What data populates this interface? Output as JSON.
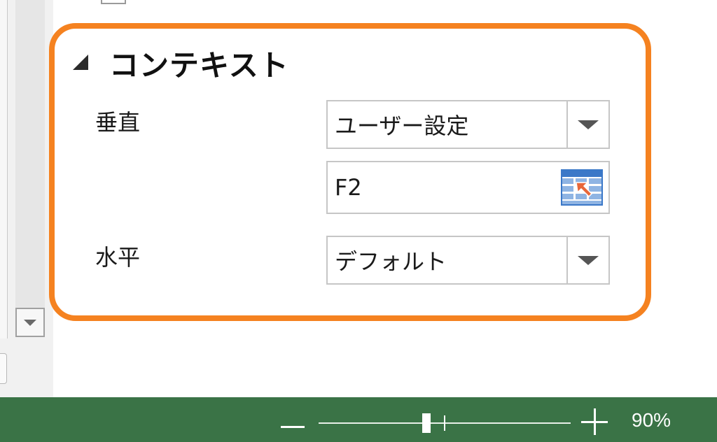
{
  "section": {
    "title": "コンテキスト"
  },
  "vertical": {
    "label": "垂直",
    "selected": "ユーザー設定",
    "reference": "F2"
  },
  "horizontal": {
    "label": "水平",
    "selected": "デフォルト"
  },
  "status_bar": {
    "zoom_level": "90%",
    "zoom_value": 90
  },
  "colors": {
    "highlight": "#f58220",
    "status_bar": "#3a7346",
    "range_icon_blue": "#3b78c8",
    "range_icon_arrow": "#e8673a"
  },
  "icons": {
    "collapse": "triangle-collapse-icon",
    "dropdown": "chevron-down-icon",
    "range_select": "range-select-icon",
    "zoom_out": "minus-icon",
    "zoom_in": "plus-icon"
  }
}
